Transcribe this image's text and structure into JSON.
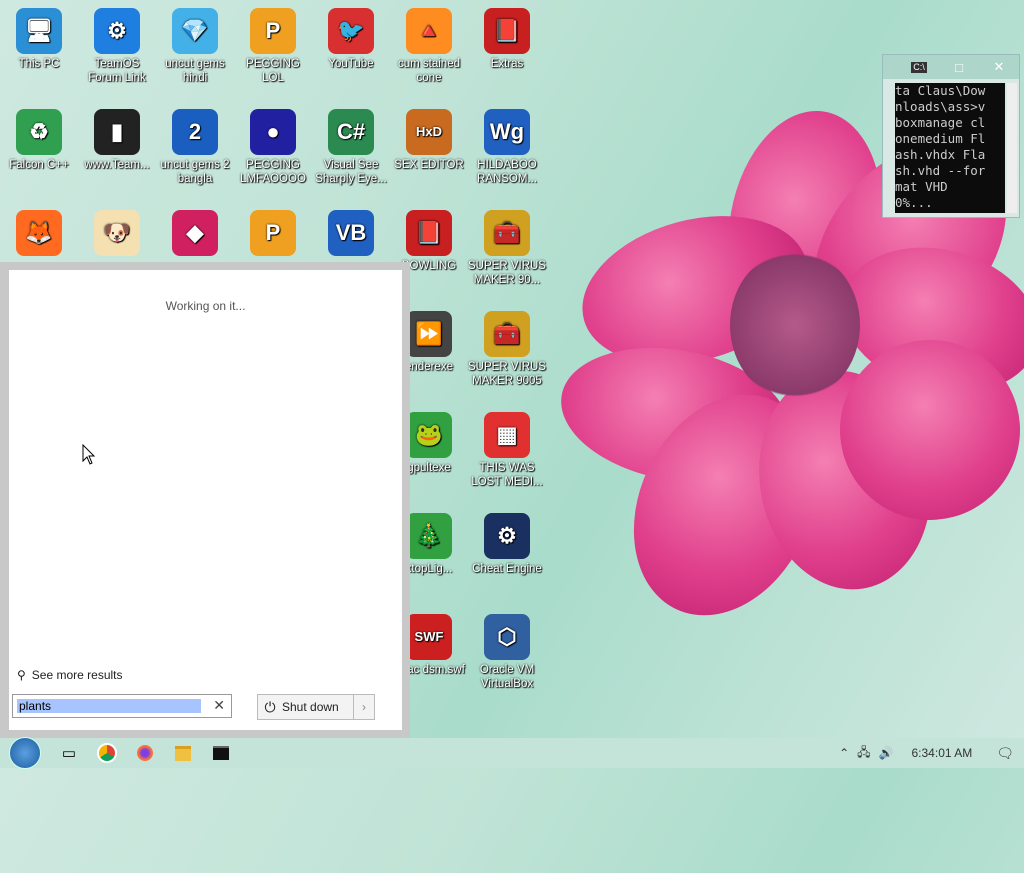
{
  "desktop_icons": [
    {
      "label": "This PC",
      "glyph": "🖥"
    },
    {
      "label": "TeamOS Forum Link",
      "glyph": "⚙"
    },
    {
      "label": "uncut gems hindi",
      "glyph": "💎"
    },
    {
      "label": "PEGGING LOL",
      "glyph": "P"
    },
    {
      "label": "YouTube",
      "glyph": "🐦"
    },
    {
      "label": "cum stained cone",
      "glyph": "🔺"
    },
    {
      "label": "Extras",
      "glyph": "📕"
    },
    {
      "label": "Falcon C++",
      "glyph": "♻"
    },
    {
      "label": "www.Team...",
      "glyph": "▮"
    },
    {
      "label": "uncut gems 2 bangla",
      "glyph": "2"
    },
    {
      "label": "PEGGING LMFAOOOO",
      "glyph": "●"
    },
    {
      "label": "Visual See Sharply Eye...",
      "glyph": "C#"
    },
    {
      "label": "SEX EDITOR",
      "glyph": "HxD"
    },
    {
      "label": "HILDABOO RANSOM...",
      "glyph": "Wg"
    },
    {
      "label": "",
      "glyph": "🦊"
    },
    {
      "label": "",
      "glyph": "🐶"
    },
    {
      "label": "",
      "glyph": "◆"
    },
    {
      "label": "",
      "glyph": "P"
    },
    {
      "label": "",
      "glyph": "VB"
    },
    {
      "label": "BOWLING",
      "glyph": "📕"
    },
    {
      "label": "SUPER VIRUS MAKER 90...",
      "glyph": "🧰"
    },
    {
      "label": "enderexe",
      "glyph": "⏩"
    },
    {
      "label": "SUPER VIRUS MAKER 9005",
      "glyph": "🧰"
    },
    {
      "label": "gpultexe",
      "glyph": "🐸"
    },
    {
      "label": "THIS WAS LOST MEDI...",
      "glyph": "▦"
    },
    {
      "label": "ktopLig...",
      "glyph": "🎄"
    },
    {
      "label": "Cheat Engine",
      "glyph": "⚙"
    },
    {
      "label": "issac dsm.swf",
      "glyph": "SWF"
    },
    {
      "label": "Oracle VM VirtualBox",
      "glyph": "⬡"
    }
  ],
  "cmd": {
    "title_icon": "C:\\",
    "output": "ta Claus\\Dow\nnloads\\ass>v\nboxmanage cl\nonemedium Fl\nash.vhdx Fla\nsh.vhd --for\nmat VHD\n0%..."
  },
  "start_menu": {
    "status": "Working on it...",
    "see_more": "See more results",
    "search_value": "plants",
    "shutdown_label": "Shut down"
  },
  "taskbar": {
    "clock": "6:34:01 AM"
  }
}
